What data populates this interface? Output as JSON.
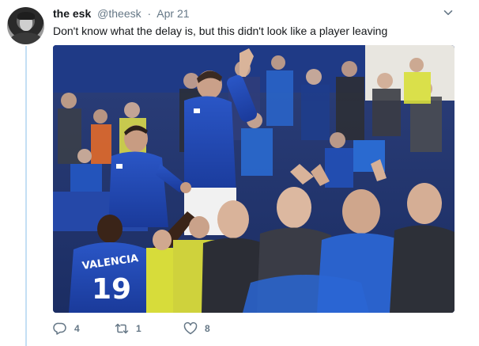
{
  "tweet": {
    "author_name": "the esk",
    "author_handle": "@theesk",
    "separator": "·",
    "date": "Apr 21",
    "text": "Don't know what the delay is, but this didn't look like a player leaving",
    "media": {
      "shirt_name": "VALENCIA",
      "shirt_number": "19"
    },
    "stats": {
      "replies": "4",
      "retweets": "1",
      "likes": "8"
    }
  },
  "icons": {
    "avatar": "user-avatar",
    "menu": "chevron-down-icon",
    "reply": "reply-bubble-icon",
    "retweet": "retweet-arrows-icon",
    "like": "heart-icon"
  },
  "colors": {
    "thread_line": "#c4dff4",
    "secondary_text": "#657786",
    "primary_text": "#14171a",
    "everton_blue": "#1d3a8a"
  }
}
